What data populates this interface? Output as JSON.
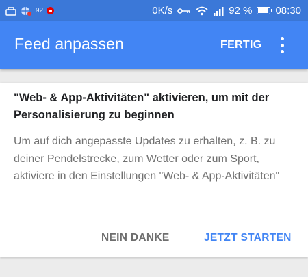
{
  "status_bar": {
    "notif_badge": "92",
    "network_speed": "0K/s",
    "battery_percent": "92 %",
    "time": "08:30",
    "icons": [
      "notification-icon",
      "app-icon",
      "vodafone-icon",
      "key-icon",
      "wifi-icon",
      "signal-icon",
      "battery-icon"
    ]
  },
  "appbar": {
    "title": "Feed anpassen",
    "action_label": "FERTIG",
    "overflow_icon": "more-vert-icon"
  },
  "card": {
    "title": "\"Web- & App-Aktivitäten\" aktivieren, um mit der Personalisierung zu beginnen",
    "body": "Um auf dich angepasste Updates zu erhalten, z. B. zu deiner Pendelstrecke, zum Wetter oder zum Sport, aktiviere in den Einstellungen \"Web- & App-Aktivitäten\"",
    "decline_label": "NEIN DANKE",
    "start_label": "JETZT STARTEN"
  },
  "colors": {
    "status_bar": "#3b78d8",
    "app_bar": "#4285f4",
    "accent": "#4285f4"
  }
}
